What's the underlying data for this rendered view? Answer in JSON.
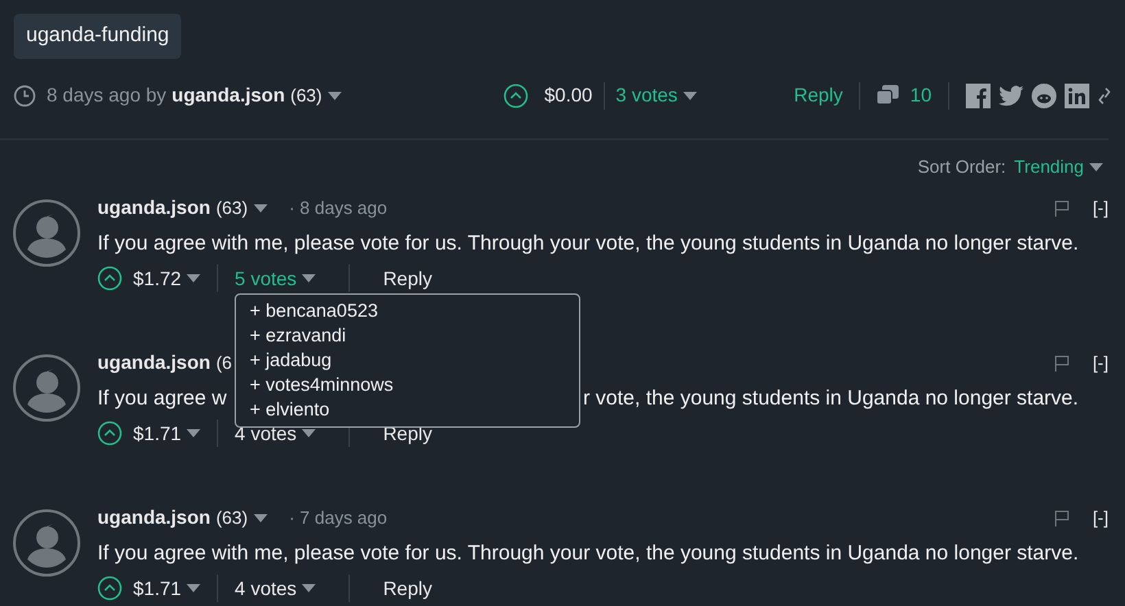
{
  "tag": "uganda-funding",
  "post": {
    "time": "8 days ago by",
    "author": "uganda.json",
    "reputation": "(63)",
    "payout": "$0.00",
    "votes": "3 votes",
    "reply": "Reply",
    "comments_count": "10"
  },
  "sort": {
    "label": "Sort Order:",
    "value": "Trending"
  },
  "comments": [
    {
      "author": "uganda.json",
      "reputation": "(63)",
      "time": "· 8 days ago",
      "body": "If you agree with me, please vote for us. Through your vote, the young students in Uganda no longer starve.",
      "payout": "$1.72",
      "votes": "5 votes",
      "votes_open": true,
      "voters": [
        "+ bencana0523",
        "+ ezravandi",
        "+ jadabug",
        "+ votes4minnows",
        "+ elviento"
      ],
      "reply": "Reply",
      "collapse": "[-]"
    },
    {
      "author": "uganda.json",
      "reputation": "(6",
      "body_parts": [
        "If you agree w",
        "r vote, the young students in Uganda no longer starve."
      ],
      "payout": "$1.71",
      "votes": "4 votes",
      "votes_open": false,
      "reply": "Reply",
      "collapse": "[-]"
    },
    {
      "author": "uganda.json",
      "reputation": "(63)",
      "time": "· 7 days ago",
      "body": "If you agree with me, please vote for us. Through your vote, the young students in Uganda no longer starve.",
      "payout": "$1.71",
      "votes": "4 votes",
      "votes_open": false,
      "reply": "Reply",
      "collapse": "[-]"
    }
  ]
}
